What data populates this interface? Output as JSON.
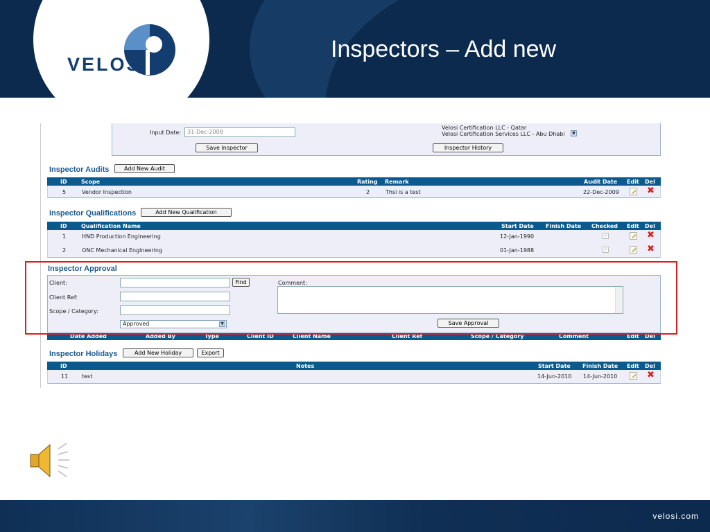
{
  "slide": {
    "title": "Inspectors – Add new",
    "logo_text": "VELOSI",
    "footer_url": "velosi.com"
  },
  "top_panel": {
    "input_date_label": "Input Date:",
    "input_date_value": "31-Dec-2008",
    "companies": [
      "Velosi Certification LLC - Qatar",
      "Velosi Certification Services LLC - Abu Dhabi"
    ],
    "save_button": "Save Inspector",
    "history_button": "Inspector History"
  },
  "audits": {
    "title": "Inspector Audits",
    "add_button": "Add New Audit",
    "headers": {
      "id": "ID",
      "scope": "Scope",
      "rating": "Rating",
      "remark": "Remark",
      "date": "Audit Date",
      "edit": "Edit",
      "del": "Del"
    },
    "rows": [
      {
        "id": "5",
        "scope": "Vendor Inspection",
        "rating": "2",
        "remark": "Thsi is a test",
        "date": "22-Dec-2009"
      }
    ]
  },
  "qualifications": {
    "title": "Inspector Qualifications",
    "add_button": "Add New Qualification",
    "headers": {
      "id": "ID",
      "name": "Qualification Name",
      "start": "Start Date",
      "finish": "Finish Date",
      "checked": "Checked",
      "edit": "Edit",
      "del": "Del"
    },
    "rows": [
      {
        "id": "1",
        "name": "HND Production Engineering",
        "start": "12-Jan-1990",
        "finish": ""
      },
      {
        "id": "2",
        "name": "ONC Mechanical Engineering",
        "start": "01-Jan-1988",
        "finish": ""
      }
    ]
  },
  "approval": {
    "title": "Inspector Approval",
    "client_label": "Client:",
    "find_button": "Find",
    "client_ref_label": "Client Ref:",
    "scope_label": "Scope / Category:",
    "comment_label": "Comment:",
    "status_selected": "Approved",
    "save_button": "Save Approval",
    "headers": {
      "date": "Date Added",
      "by": "Added By",
      "type": "Type",
      "client_id": "Client ID",
      "client_name": "Client Name",
      "client_ref": "Client Ref",
      "scope": "Scope / Category",
      "comment": "Comment",
      "edit": "Edit",
      "del": "Del"
    }
  },
  "holidays": {
    "title": "Inspector Holidays",
    "add_button": "Add New Holiday",
    "export_button": "Export",
    "headers": {
      "id": "ID",
      "notes": "Notes",
      "start": "Start Date",
      "finish": "Finish Date",
      "edit": "Edit",
      "del": "Del"
    },
    "rows": [
      {
        "id": "11",
        "notes": "test",
        "start": "14-Jun-2010",
        "finish": "14-Jun-2010"
      }
    ]
  },
  "icons": {
    "edit": "edit-icon",
    "delete": "delete-icon",
    "speaker": "speaker-icon"
  },
  "colors": {
    "header_bg": "#0c2a4e",
    "table_header": "#0b5a8e",
    "section_title": "#1e5a90",
    "highlight": "#d62020",
    "delete": "#dd1c1c"
  }
}
